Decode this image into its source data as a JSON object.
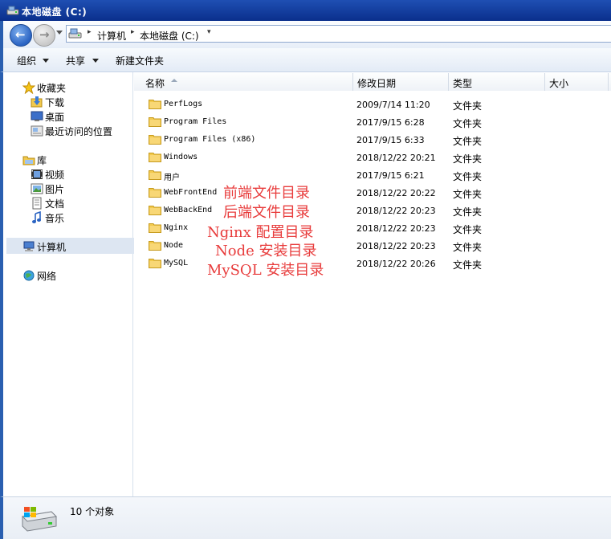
{
  "window": {
    "title": "本地磁盘  (C:)"
  },
  "nav": {
    "back": "back",
    "forward": "forward",
    "crumbs": [
      "计算机",
      "本地磁盘 (C:)"
    ]
  },
  "toolbar": {
    "organize": "组织",
    "share": "共享",
    "new_folder": "新建文件夹"
  },
  "sidebar": {
    "favorites": {
      "label": "收藏夹",
      "items": [
        "下载",
        "桌面",
        "最近访问的位置"
      ]
    },
    "libraries": {
      "label": "库",
      "items": [
        "视频",
        "图片",
        "文档",
        "音乐"
      ]
    },
    "computer": "计算机",
    "network": "网络"
  },
  "columns": {
    "name": "名称",
    "date": "修改日期",
    "type": "类型",
    "size": "大小"
  },
  "files": [
    {
      "name": "PerfLogs",
      "date": "2009/7/14 11:20",
      "type": "文件夹"
    },
    {
      "name": "Program Files",
      "date": "2017/9/15 6:28",
      "type": "文件夹"
    },
    {
      "name": "Program Files (x86)",
      "date": "2017/9/15 6:33",
      "type": "文件夹"
    },
    {
      "name": "Windows",
      "date": "2018/12/22 20:21",
      "type": "文件夹"
    },
    {
      "name": "用户",
      "date": "2017/9/15 6:21",
      "type": "文件夹"
    },
    {
      "name": "WebFrontEnd",
      "date": "2018/12/22 20:22",
      "type": "文件夹"
    },
    {
      "name": "WebBackEnd",
      "date": "2018/12/22 20:23",
      "type": "文件夹"
    },
    {
      "name": "Nginx",
      "date": "2018/12/22 20:23",
      "type": "文件夹"
    },
    {
      "name": "Node",
      "date": "2018/12/22 20:23",
      "type": "文件夹"
    },
    {
      "name": "MySQL",
      "date": "2018/12/22 20:26",
      "type": "文件夹"
    }
  ],
  "annotations": [
    "前端文件目录",
    "后端文件目录",
    "Nginx 配置目录",
    "Node 安装目录",
    "MySQL 安装目录"
  ],
  "status": {
    "count": "10 个对象"
  },
  "colors": {
    "annotation": "#e83c3c",
    "title_bar": "#0a2f8c",
    "folder": "#f2c94c"
  }
}
